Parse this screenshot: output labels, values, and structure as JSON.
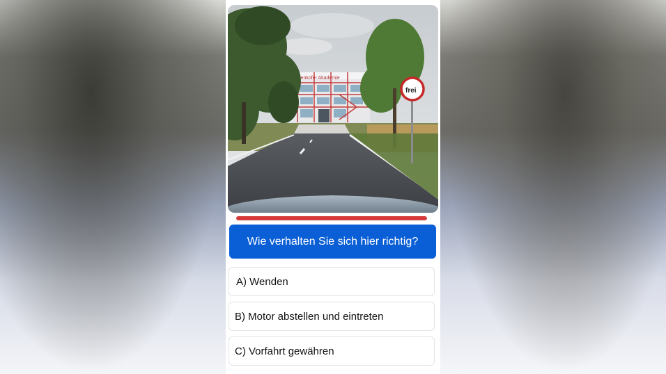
{
  "quiz": {
    "question": "Wie verhalten Sie sich hier richtig?",
    "progress_fraction": 1.0,
    "answers": [
      {
        "label": "A) Wenden"
      },
      {
        "label": "B) Motor abstellen und eintreten"
      },
      {
        "label": "C) Vorfahrt gewähren"
      }
    ]
  },
  "photo": {
    "building_sign": "Attenkofer Akademie",
    "road_sign_text": "frei"
  },
  "colors": {
    "question_bg": "#0b5fd6",
    "progress": "#d63a3a",
    "answer_border": "#e2e4e8"
  }
}
